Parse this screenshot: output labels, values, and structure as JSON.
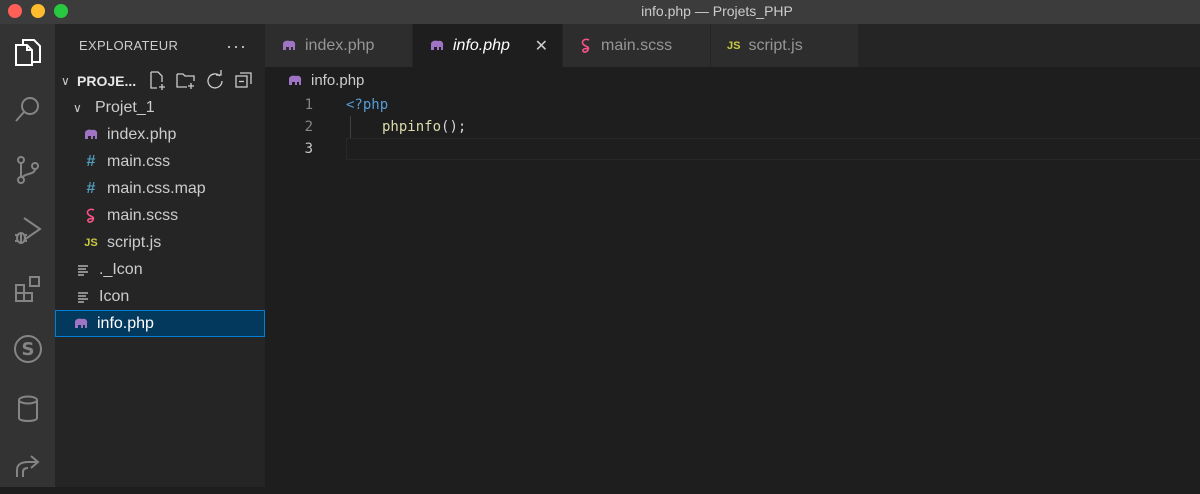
{
  "window": {
    "title": "info.php — Projets_PHP"
  },
  "colors": {
    "php_icon": "#a074c4",
    "sass_icon": "#f55385",
    "css_icon": "#519aba",
    "js_icon": "#cbcb41",
    "selection_bg": "#04395e",
    "selection_border": "#007fd4"
  },
  "activitybar": {
    "icons": [
      "files-icon",
      "search-icon",
      "source-control-icon",
      "run-debug-icon",
      "extensions-icon",
      "s-extension-icon",
      "database-icon",
      "remote-share-icon"
    ]
  },
  "sidebar": {
    "title": "EXPLORATEUR",
    "more": "···",
    "section_label": "PROJE...",
    "folder": "Projet_1",
    "folder_files": [
      {
        "name": "index.php",
        "icon": "php-icon"
      },
      {
        "name": "main.css",
        "icon": "hash-icon",
        "glyph": "#"
      },
      {
        "name": "main.css.map",
        "icon": "hash-icon",
        "glyph": "#"
      },
      {
        "name": "main.scss",
        "icon": "sass-icon"
      },
      {
        "name": "script.js",
        "icon": "js-icon",
        "glyph": "JS"
      }
    ],
    "root_files": [
      {
        "name": "._Icon",
        "icon": "lines-icon"
      },
      {
        "name": "Icon",
        "icon": "lines-icon"
      },
      {
        "name": "info.php",
        "icon": "php-icon",
        "selected": true
      }
    ]
  },
  "tabs": [
    {
      "label": "index.php",
      "icon": "php-icon"
    },
    {
      "label": "info.php",
      "icon": "php-icon",
      "active": true,
      "close": "✕"
    },
    {
      "label": "main.scss",
      "icon": "sass-icon"
    },
    {
      "label": "script.js",
      "icon": "js-icon",
      "glyph": "JS"
    }
  ],
  "breadcrumb": {
    "file": "info.php"
  },
  "editor": {
    "lines": [
      {
        "number": "1",
        "text": "<?php"
      },
      {
        "number": "2",
        "fn": "phpinfo",
        "punc": "();"
      },
      {
        "number": "3",
        "text": ""
      }
    ]
  }
}
